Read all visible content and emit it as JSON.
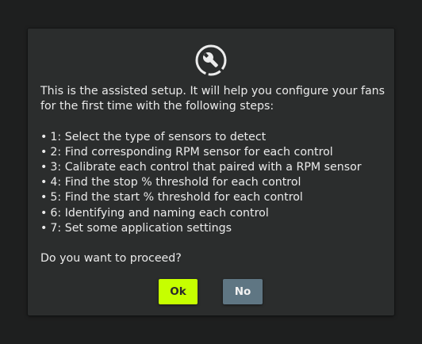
{
  "dialog": {
    "icon": "wrench-progress-icon",
    "intro": "This is the assisted setup. It will help you configure your fans for the first time with the following steps:",
    "bullet": "•",
    "steps": [
      "1: Select the type of sensors to detect",
      "2: Find corresponding RPM sensor for each control",
      "3: Calibrate each control that paired with a RPM sensor",
      "4: Find the stop % threshold for each control",
      "5: Find the start % threshold for each control",
      "6: Identifying and naming each control",
      "7: Set some application settings"
    ],
    "question": "Do you want to proceed?",
    "ok_label": "Ok",
    "no_label": "No"
  },
  "colors": {
    "background": "#1e1f1f",
    "dialog": "#2b2d2d",
    "text": "#eaeaea",
    "ok_button": "#c6ff00",
    "no_button": "#5f7683"
  }
}
